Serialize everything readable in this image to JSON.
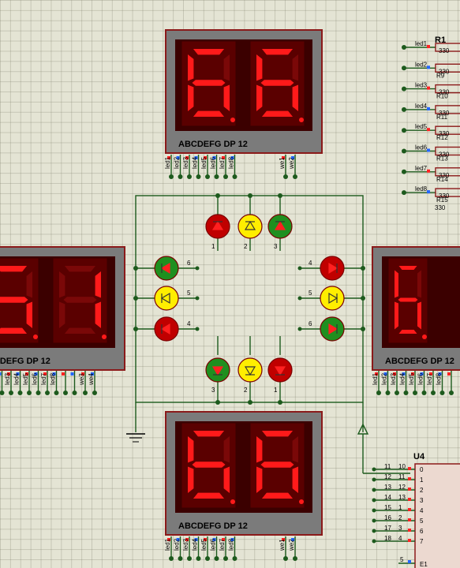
{
  "displays": {
    "pinout_label": "ABCDEFG  DP     12",
    "top": {
      "digits": [
        "6",
        "6"
      ]
    },
    "left": {
      "digits": [
        "5",
        "1"
      ]
    },
    "right": {
      "digits": [
        "6"
      ]
    },
    "bottom": {
      "digits": [
        "6",
        "6"
      ]
    }
  },
  "net_labels": {
    "top": [
      "led1",
      "led2",
      "led3",
      "led4",
      "led5",
      "led6",
      "led7",
      "led8",
      "we1",
      "we2"
    ],
    "left": [
      "led3",
      "led4",
      "led5",
      "led6",
      "led7",
      "led8",
      "we3",
      "we4"
    ],
    "right": [
      "led1",
      "led2",
      "led3",
      "led4",
      "led5",
      "led6",
      "led7",
      "led8"
    ],
    "bottom": [
      "led1",
      "led2",
      "led3",
      "led4",
      "led5",
      "led6",
      "led7",
      "led8",
      "we1",
      "we2"
    ]
  },
  "resistor_bank": {
    "title": "R1",
    "names": [
      "R9",
      "R10",
      "R11",
      "R12",
      "R13",
      "R14",
      "R15"
    ],
    "value": "330",
    "net_labels": [
      "led1",
      "led2",
      "led3",
      "led4",
      "led5",
      "led6",
      "led7",
      "led8"
    ]
  },
  "leds": {
    "top_pins": [
      "1",
      "2",
      "3"
    ],
    "left_pins": [
      "6",
      "5",
      "4"
    ],
    "right_pins": [
      "4",
      "5",
      "6"
    ],
    "bottom_pins": [
      "3",
      "2",
      "1"
    ]
  },
  "chip": {
    "title": "U4",
    "left_nums": [
      "11",
      "12",
      "13",
      "14",
      "15",
      "16",
      "17",
      "18"
    ],
    "inner_nums": [
      "10",
      "11",
      "12",
      "13",
      "1",
      "2",
      "3",
      "4"
    ],
    "out_nums": [
      "0",
      "1",
      "2",
      "3",
      "4",
      "5",
      "6",
      "7"
    ],
    "bottom_pin": "5",
    "bottom_label": "E1"
  },
  "colors": {
    "led_red_on": "#c00000",
    "led_yellow_on": "#ffee00",
    "led_green_on": "#1f8f1f",
    "segment_on": "#ff1a1a",
    "wire": "#1d5a1d"
  }
}
